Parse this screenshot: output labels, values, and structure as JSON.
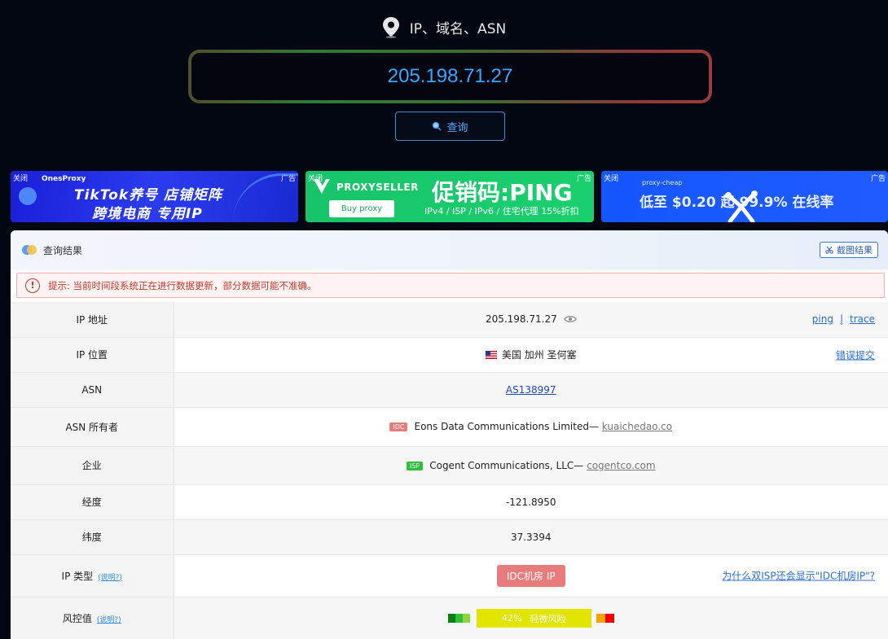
{
  "hero": {
    "label": "IP、域名、ASN",
    "search_value": "205.198.71.27",
    "query_label": "查询"
  },
  "ads": [
    {
      "close": "关闭",
      "tag": "广告",
      "brand": "OnesProxy",
      "line1": "TikTok养号 店铺矩阵",
      "line2": "跨境电商 专用IP"
    },
    {
      "close": "关闭",
      "tag": "广告",
      "brand": "PROXYSELLER",
      "button": "Buy proxy",
      "promo": "促销码:PING",
      "sub": "IPv4 / ISP / IPv6 / 住宅代理 15%折扣"
    },
    {
      "close": "关闭",
      "tag": "广告",
      "brand": "proxy-cheap",
      "text": "低至 $0.20 起  99.9% 在线率"
    }
  ],
  "panel": {
    "title": "查询结果",
    "screenshot_label": "截图结果",
    "notice": "提示: 当前时间段系统正在进行数据更新，部分数据可能不准确。"
  },
  "rows": {
    "ip_label": "IP 地址",
    "ip_value": "205.198.71.27",
    "ping": "ping",
    "sep": "|",
    "trace": "trace",
    "loc_label": "IP 位置",
    "loc_value": "美国 加州 圣何塞",
    "loc_report": "错误提交",
    "asn_label": "ASN",
    "asn_value": "AS138997",
    "owner_label": "ASN 所有者",
    "owner_badge": "IDC",
    "owner_name": "Eons Data Communications Limited—",
    "owner_domain": "kuaichedao.co",
    "org_label": "企业",
    "org_badge": "ISP",
    "org_name": "Cogent Communications, LLC—",
    "org_domain": "cogentco.com",
    "lon_label": "经度",
    "lon_value": "-121.8950",
    "lat_label": "纬度",
    "lat_value": "37.3394",
    "type_label": "IP 类型",
    "type_help": "(说明?)",
    "type_value": "IDC机房 IP",
    "type_why": "为什么双ISP还会显示\"IDC机房IP\"?",
    "risk_label": "风控值",
    "risk_help": "(说明?)",
    "risk_percent": "42%",
    "risk_text": "轻微风险"
  },
  "colors": {
    "accent_blue": "#35a7ff",
    "idc_badge": "#e87b7b",
    "isp_badge": "#2fbf3a",
    "risk_yellow": "#e1e500"
  }
}
